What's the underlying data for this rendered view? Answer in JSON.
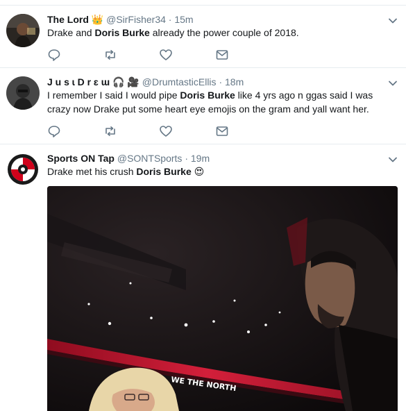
{
  "tweets": [
    {
      "name": "The Lord",
      "name_emoji": "👑",
      "handle": "@SirFisher34",
      "dot": "·",
      "time": "15m",
      "text": {
        "pre": "Drake and ",
        "bold": "Doris Burke",
        "post": " already the power couple of 2018."
      }
    },
    {
      "name": "J u s ɩ D r ɛ ɯ",
      "name_emoji": "🎧 🎥",
      "handle": "@DrumtasticEllis",
      "dot": "·",
      "time": "18m",
      "text": {
        "pre": "I remember I said I would pipe ",
        "bold": "Doris Burke",
        "post": " like 4 yrs ago n ɡgas said I was crazy now Drake put some heart eye emojis on the gram and yall want her."
      }
    },
    {
      "name": "Sports ON Tap",
      "name_emoji": "",
      "handle": "@SONTSports",
      "dot": "·",
      "time": "19m",
      "text": {
        "pre": "Drake met his crush ",
        "bold": "Doris Burke",
        "post": " 😍"
      },
      "media": {
        "banner_text": "WE THE NORTH"
      }
    }
  ],
  "icons": [
    "reply-icon",
    "retweet-icon",
    "like-icon",
    "message-icon",
    "chevron-down-icon"
  ],
  "colors": {
    "text": "#14171a",
    "secondary": "#657786",
    "icon": "#657786",
    "divider": "#e6ecf0",
    "court_red": "#c8102e"
  }
}
